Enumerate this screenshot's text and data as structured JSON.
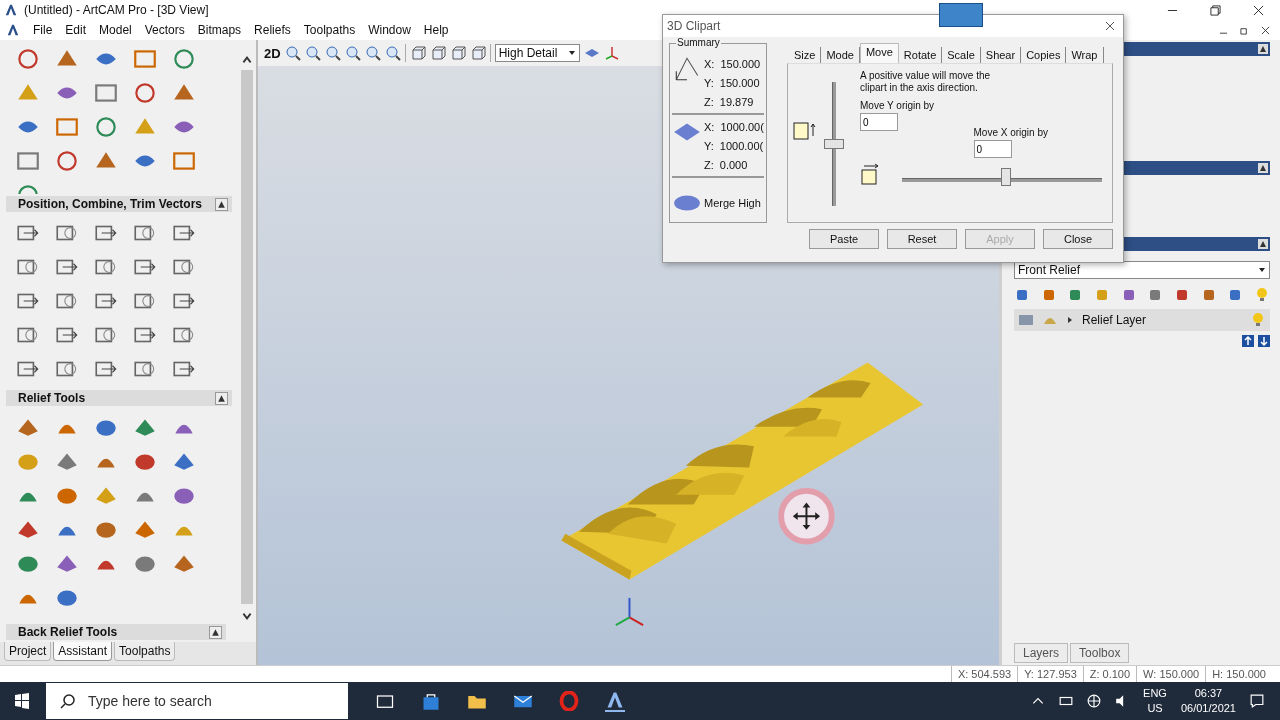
{
  "window": {
    "title": "(Untitled) - ArtCAM Pro - [3D View]"
  },
  "menu": [
    "File",
    "Edit",
    "Model",
    "Vectors",
    "Bitmaps",
    "Reliefs",
    "Toolpaths",
    "Window",
    "Help"
  ],
  "left_panel": {
    "sections": [
      {
        "title": "Position, Combine, Trim Vectors"
      },
      {
        "title": "Relief Tools"
      },
      {
        "title": "Back Relief Tools"
      }
    ],
    "tabs": [
      {
        "label": "Project",
        "selected": false
      },
      {
        "label": "Assistant",
        "selected": true
      },
      {
        "label": "Toolpaths",
        "selected": false
      }
    ]
  },
  "view_toolbar": {
    "mode_label": "2D",
    "detail": "High Detail"
  },
  "dialog": {
    "title": "3D Clipart",
    "summary_title": "Summary",
    "clipart": [
      {
        "axis": "X:",
        "value": "150.000"
      },
      {
        "axis": "Y:",
        "value": "150.000"
      },
      {
        "axis": "Z:",
        "value": "19.879"
      }
    ],
    "block": [
      {
        "axis": "X:",
        "value": "1000.00("
      },
      {
        "axis": "Y:",
        "value": "1000.00("
      },
      {
        "axis": "Z:",
        "value": "0.000"
      }
    ],
    "merge": "Merge High",
    "tabs": [
      {
        "label": "Size",
        "selected": false
      },
      {
        "label": "Mode",
        "selected": false
      },
      {
        "label": "Move",
        "selected": true
      },
      {
        "label": "Rotate",
        "selected": false
      },
      {
        "label": "Scale",
        "selected": false
      },
      {
        "label": "Shear",
        "selected": false
      },
      {
        "label": "Copies",
        "selected": false
      },
      {
        "label": "Wrap",
        "selected": false
      }
    ],
    "hint": "A positive value will move the clipart in the axis direction.",
    "y_label": "Move Y origin by",
    "y_value": "0",
    "x_label": "Move X origin by",
    "x_value": "0",
    "y_slider": {
      "level": 0.5
    },
    "x_slider": {
      "level": 0.52
    },
    "buttons": [
      {
        "label": "Paste",
        "disabled": false
      },
      {
        "label": "Reset",
        "disabled": false
      },
      {
        "label": "Apply",
        "disabled": true
      },
      {
        "label": "Close",
        "disabled": false
      }
    ]
  },
  "right_panel": {
    "relief_select": "Front Relief",
    "layer": "Relief Layer",
    "tabs": [
      "Layers",
      "Toolbox"
    ]
  },
  "status_bar": [
    "X: 504.593",
    "Y: 127.953",
    "Z: 0.100",
    "W: 150.000",
    "H: 150.000"
  ],
  "taskbar": {
    "search_placeholder": "Type here to search",
    "lang": "ENG",
    "region": "US",
    "time": "06:37",
    "date": "06/01/2021"
  }
}
